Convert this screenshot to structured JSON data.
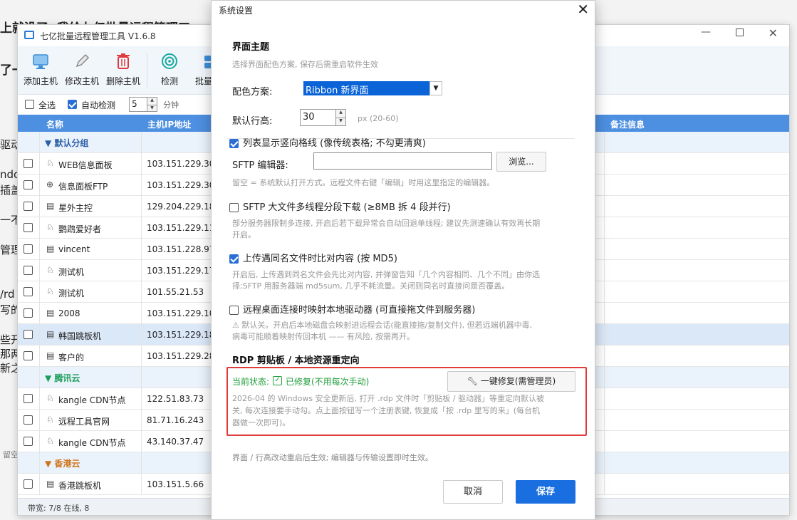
{
  "background": {
    "lines": [
      "上就没了",
      "我给七亿批量远程管理工",
      "了一",
      "驱动",
      "ndo",
      "插盖",
      "一不",
      "管理",
      "/rd",
      "写的",
      "些开",
      "那两",
      "新之",
      "留空"
    ]
  },
  "app": {
    "title": "七亿批量远程管理工具 V1.6.8",
    "toolbar": [
      {
        "label": "添加主机",
        "icon": "monitor-icon"
      },
      {
        "label": "修改主机",
        "icon": "pencil-icon"
      },
      {
        "label": "删除主机",
        "icon": "trash-icon"
      },
      {
        "label": "检测",
        "icon": "target-icon"
      },
      {
        "label": "批量",
        "icon": "batch-icon"
      }
    ],
    "options": {
      "select_all": "全选",
      "auto_detect": "自动检测",
      "interval": "5",
      "unit": "分钟"
    },
    "columns": {
      "name": "名称",
      "ip": "主机IP地址",
      "note": "备注信息"
    },
    "rows": [
      {
        "type": "group",
        "name": "▼ 默认分组",
        "color": "#2b5fa8"
      },
      {
        "type": "host",
        "name": "WEB信息面板",
        "ip": "103.151.229.30",
        "icon": "linux-icon"
      },
      {
        "type": "host",
        "name": "信息面板FTP",
        "ip": "103.151.229.30",
        "icon": "globe-icon"
      },
      {
        "type": "host",
        "name": "星外主控",
        "ip": "129.204.229.181",
        "icon": "windows-icon"
      },
      {
        "type": "host",
        "name": "鹦鹉爱好者",
        "ip": "103.151.229.11",
        "icon": "linux-icon"
      },
      {
        "type": "host",
        "name": "vincent",
        "ip": "103.151.228.97",
        "icon": "windows-icon"
      },
      {
        "type": "host",
        "name": "测试机",
        "ip": "103.151.229.17",
        "icon": "linux-icon"
      },
      {
        "type": "host",
        "name": "测试机",
        "ip": "101.55.21.53",
        "icon": "linux-icon"
      },
      {
        "type": "host",
        "name": "2008",
        "ip": "103.151.229.104",
        "icon": "windows-icon"
      },
      {
        "type": "host",
        "name": "韩国跳板机",
        "ip": "103.151.229.184",
        "icon": "windows-icon",
        "selected": true
      },
      {
        "type": "host",
        "name": "客户的",
        "ip": "103.151.229.28",
        "icon": "windows-icon"
      },
      {
        "type": "group",
        "name": "▼ 腾讯云",
        "color": "#1e9e5a"
      },
      {
        "type": "host",
        "name": "kangle CDN节点",
        "ip": "122.51.83.73",
        "icon": "linux-icon"
      },
      {
        "type": "host",
        "name": "远程工具官网",
        "ip": "81.71.16.243",
        "icon": "linux-icon"
      },
      {
        "type": "host",
        "name": "kangle CDN节点",
        "ip": "43.140.37.47",
        "icon": "linux-icon"
      },
      {
        "type": "group",
        "name": "▼ 香港云",
        "color": "#d0741a"
      },
      {
        "type": "host",
        "name": "香港跳板机",
        "ip": "103.151.5.66",
        "icon": "windows-icon"
      }
    ],
    "status": "带宽: 7/8 在线, 8"
  },
  "dialog": {
    "title": "系统设置",
    "theme_section": "界面主题",
    "theme_hint": "选择界面配色方案, 保存后需重启软件生效",
    "scheme_label": "配色方案:",
    "scheme_value": "Ribbon 新界面",
    "row_height_label": "默认行高:",
    "row_height_value": "30",
    "row_height_range": "px (20-60)",
    "grid_lines": "列表显示竖向格线 (像传统表格; 不勾更清爽)",
    "sftp_editor_label": "SFTP 编辑器:",
    "browse": "浏览...",
    "sftp_editor_hint": "留空 = 系统默认打开方式。远程文件右键「编辑」时用这里指定的编辑器。",
    "multi_thread": "SFTP 大文件多线程分段下载 (≥8MB 拆 4 段并行)",
    "multi_thread_hint1": "部分服务器限制多连接, 开启后若下载异常会自动回退单线程; 建议先测速确认有效再长期",
    "multi_thread_hint2": "开启。",
    "md5": "上传遇同名文件时比对内容 (按 MD5)",
    "md5_hint1": "开启后, 上传遇到同名文件会先比对内容, 并弹窗告知「几个内容相同、几个不同」由你选",
    "md5_hint2": "择;SFTP 用服务器端 md5sum, 几乎不耗流量。关闭则同名时直接问是否覆盖。",
    "map_drive": "远程桌面连接时映射本地驱动器 (可直接拖文件到服务器)",
    "map_drive_hint1": "⚠ 默认关。开启后本地磁盘会映射进远程会话(能直接拖/复制文件), 但若远端机器中毒,",
    "map_drive_hint2": "病毒可能顺着映射传回本机 —— 有风险, 按需再开。",
    "rdp_section": "RDP 剪贴板 / 本地资源重定向",
    "current_state_label": "当前状态:",
    "current_state_value": "已修复(不用每次手动)",
    "fix_button": "一键修复(需管理员)",
    "rdp_hint1": "2026-04 的 Windows 安全更新后, 打开 .rdp 文件时「剪贴板 / 驱动器」等重定向默认被",
    "rdp_hint2": "关, 每次连接要手动勾。点上面按钮写一个注册表键, 恢复成「按 .rdp 里写的来」(每台机",
    "rdp_hint3": "器做一次即可)。",
    "footer_hint": "界面 / 行高改动重启后生效; 编辑器与传输设置即时生效。",
    "cancel": "取消",
    "save": "保存",
    "accent": "#1a6fe0",
    "state_color": "#1e9e3a"
  }
}
